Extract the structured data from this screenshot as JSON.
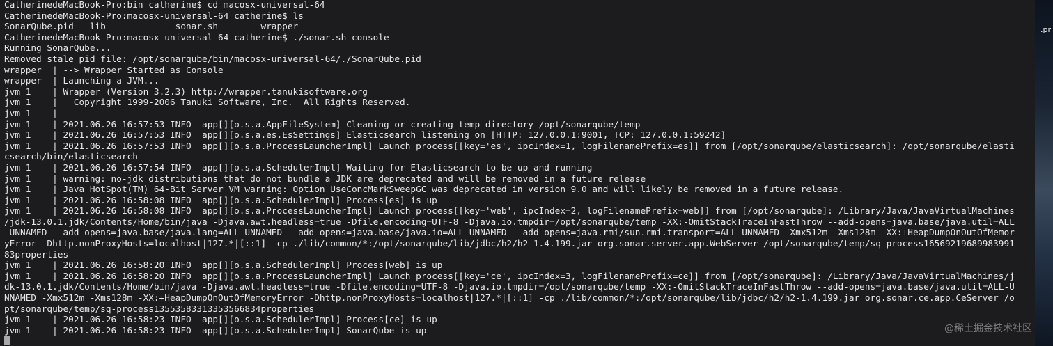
{
  "terminal": {
    "lines": [
      "CatherinedeMacBook-Pro:bin catherine$ cd macosx-universal-64",
      "CatherinedeMacBook-Pro:macosx-universal-64 catherine$ ls",
      "SonarQube.pid   lib             sonar.sh        wrapper",
      "CatherinedeMacBook-Pro:macosx-universal-64 catherine$ ./sonar.sh console",
      "Running SonarQube...",
      "Removed stale pid file: /opt/sonarqube/bin/macosx-universal-64/./SonarQube.pid",
      "wrapper  | --> Wrapper Started as Console",
      "wrapper  | Launching a JVM...",
      "jvm 1    | Wrapper (Version 3.2.3) http://wrapper.tanukisoftware.org",
      "jvm 1    |   Copyright 1999-2006 Tanuki Software, Inc.  All Rights Reserved.",
      "jvm 1    |",
      "jvm 1    | 2021.06.26 16:57:53 INFO  app[][o.s.a.AppFileSystem] Cleaning or creating temp directory /opt/sonarqube/temp",
      "jvm 1    | 2021.06.26 16:57:53 INFO  app[][o.s.a.es.EsSettings] Elasticsearch listening on [HTTP: 127.0.0.1:9001, TCP: 127.0.0.1:59242]",
      "jvm 1    | 2021.06.26 16:57:53 INFO  app[][o.s.a.ProcessLauncherImpl] Launch process[[key='es', ipcIndex=1, logFilenamePrefix=es]] from [/opt/sonarqube/elasticsearch]: /opt/sonarqube/elasti",
      "csearch/bin/elasticsearch",
      "jvm 1    | 2021.06.26 16:57:54 INFO  app[][o.s.a.SchedulerImpl] Waiting for Elasticsearch to be up and running",
      "jvm 1    | warning: no-jdk distributions that do not bundle a JDK are deprecated and will be removed in a future release",
      "jvm 1    | Java HotSpot(TM) 64-Bit Server VM warning: Option UseConcMarkSweepGC was deprecated in version 9.0 and will likely be removed in a future release.",
      "jvm 1    | 2021.06.26 16:58:08 INFO  app[][o.s.a.SchedulerImpl] Process[es] is up",
      "jvm 1    | 2021.06.26 16:58:08 INFO  app[][o.s.a.ProcessLauncherImpl] Launch process[[key='web', ipcIndex=2, logFilenamePrefix=web]] from [/opt/sonarqube]: /Library/Java/JavaVirtualMachines",
      "/jdk-13.0.1.jdk/Contents/Home/bin/java -Djava.awt.headless=true -Dfile.encoding=UTF-8 -Djava.io.tmpdir=/opt/sonarqube/temp -XX:-OmitStackTraceInFastThrow --add-opens=java.base/java.util=ALL",
      "-UNNAMED --add-opens=java.base/java.lang=ALL-UNNAMED --add-opens=java.base/java.io=ALL-UNNAMED --add-opens=java.rmi/sun.rmi.transport=ALL-UNNAMED -Xmx512m -Xms128m -XX:+HeapDumpOnOutOfMemor",
      "yError -Dhttp.nonProxyHosts=localhost|127.*|[::1] -cp ./lib/common/*:/opt/sonarqube/lib/jdbc/h2/h2-1.4.199.jar org.sonar.server.app.WebServer /opt/sonarqube/temp/sq-process16569219689983991",
      "83properties",
      "jvm 1    | 2021.06.26 16:58:20 INFO  app[][o.s.a.SchedulerImpl] Process[web] is up",
      "jvm 1    | 2021.06.26 16:58:20 INFO  app[][o.s.a.ProcessLauncherImpl] Launch process[[key='ce', ipcIndex=3, logFilenamePrefix=ce]] from [/opt/sonarqube]: /Library/Java/JavaVirtualMachines/j",
      "dk-13.0.1.jdk/Contents/Home/bin/java -Djava.awt.headless=true -Dfile.encoding=UTF-8 -Djava.io.tmpdir=/opt/sonarqube/temp -XX:-OmitStackTraceInFastThrow --add-opens=java.base/java.util=ALL-U",
      "NNAMED -Xmx512m -Xms128m -XX:+HeapDumpOnOutOfMemoryError -Dhttp.nonProxyHosts=localhost|127.*|[::1] -cp ./lib/common/*:/opt/sonarqube/lib/jdbc/h2/h2-1.4.199.jar org.sonar.ce.app.CeServer /o",
      "pt/sonarqube/temp/sq-process13553583313353566834properties",
      "jvm 1    | 2021.06.26 16:58:23 INFO  app[][o.s.a.SchedulerImpl] Process[ce] is up",
      "jvm 1    | 2021.06.26 16:58:23 INFO  app[][o.s.a.SchedulerImpl] SonarQube is up"
    ]
  },
  "desktop": {
    "file_label": ".pr"
  },
  "watermark": {
    "text": "@稀土掘金技术社区"
  },
  "colors": {
    "terminal_background": "#1c1c1e",
    "terminal_text": "#e6e6e6",
    "cursor": "#a9a9a9"
  }
}
